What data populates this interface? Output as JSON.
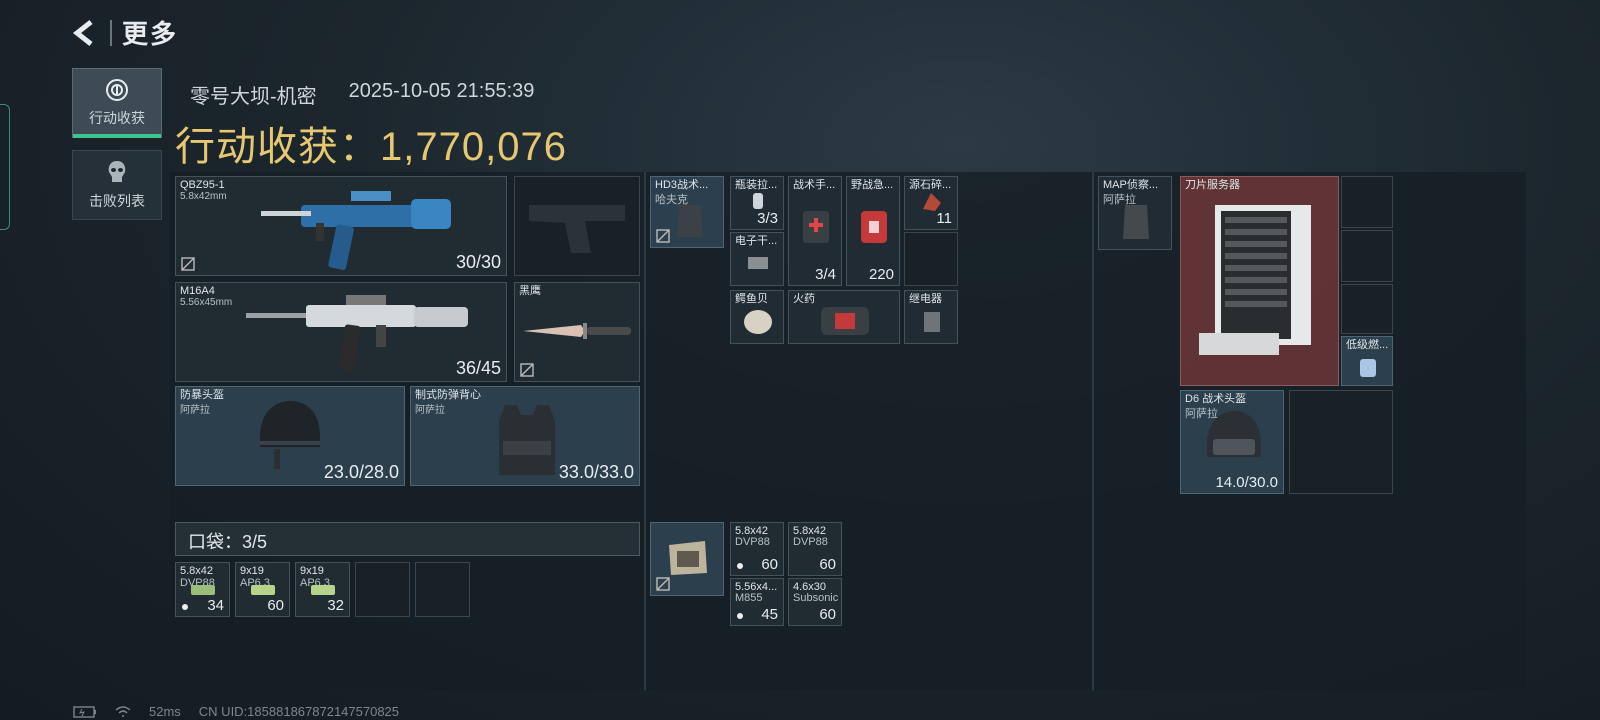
{
  "header": {
    "title": "更多"
  },
  "tabs": [
    {
      "label": "行动收获",
      "active": true
    },
    {
      "label": "击败列表",
      "active": false
    }
  ],
  "summary": {
    "map": "零号大坝-机密",
    "datetime": "2025-10-05 21:55:39",
    "harvest_label": "行动收获：",
    "harvest_value": "1,770,076"
  },
  "loadout": {
    "primary": {
      "name": "QBZ95-1",
      "caliber": "5.8x42mm",
      "ammo": "30/30"
    },
    "secondary": {
      "name": "M16A4",
      "caliber": "5.56x45mm",
      "ammo": "36/45"
    },
    "melee": {
      "name": "黑鹰"
    },
    "helmet": {
      "name": "防暴头盔",
      "brand": "阿萨拉",
      "durability": "23.0/28.0"
    },
    "armor": {
      "name": "制式防弹背心",
      "brand": "阿萨拉",
      "durability": "33.0/33.0"
    }
  },
  "pocket": {
    "label": "口袋：3/5",
    "items": [
      {
        "name": "5.8x42",
        "sub": "DVP88",
        "count": "34"
      },
      {
        "name": "9x19",
        "sub": "AP6.3",
        "count": "60"
      },
      {
        "name": "9x19",
        "sub": "AP6.3",
        "count": "32"
      }
    ]
  },
  "rig": {
    "name": "HD3战术...",
    "brand": "哈夫克",
    "items": [
      {
        "name": "瓶装拉...",
        "count": "3/3"
      },
      {
        "name": "战术手...",
        "count": "3/4"
      },
      {
        "name": "野战急...",
        "count": "220"
      },
      {
        "name": "源石碎...",
        "count": "11"
      },
      {
        "name": "电子干..."
      },
      {
        "name": "鳄鱼贝"
      },
      {
        "name": "火药"
      },
      {
        "name": "继电器"
      }
    ]
  },
  "bag": {
    "items": [
      {
        "name": "5.8x42",
        "sub": "DVP88",
        "count": "60"
      },
      {
        "name": "5.8x42",
        "sub": "DVP88",
        "count": "60"
      },
      {
        "name": "5.56x4...",
        "sub": "M855",
        "count": "45"
      },
      {
        "name": "4.6x30",
        "sub": "Subsonic",
        "count": "60"
      }
    ]
  },
  "backpack": {
    "name": "MAP侦察...",
    "brand": "阿萨拉",
    "items": [
      {
        "name": "刀片服务器"
      },
      {
        "name": "低级燃..."
      },
      {
        "name": "D6 战术头盔",
        "brand": "阿萨拉",
        "durability": "14.0/30.0"
      }
    ]
  },
  "status_bar": {
    "ping": "52ms",
    "uid": "CN UID:1858818678721475708​25"
  }
}
